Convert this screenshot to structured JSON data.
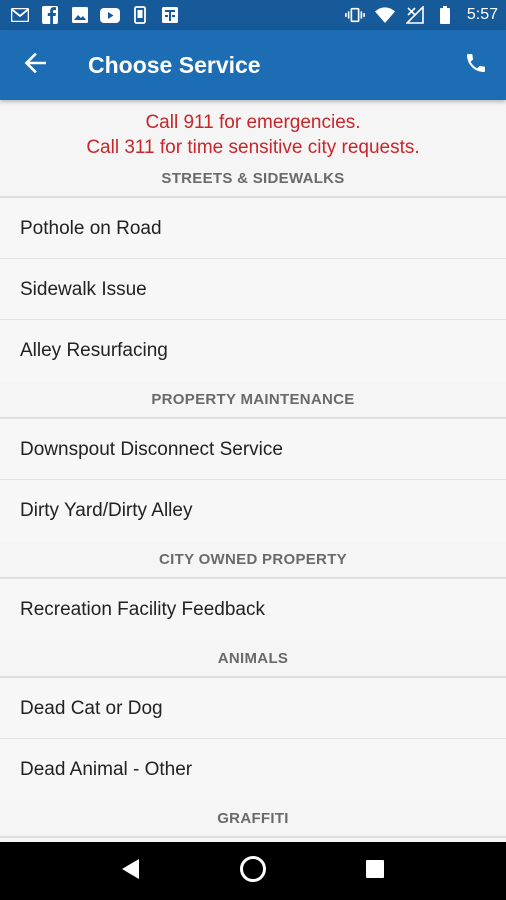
{
  "status_bar": {
    "time": "5:57",
    "left_icons": [
      "gmail-icon",
      "facebook-icon",
      "photo-icon",
      "youtube-icon",
      "device-icon",
      "news-icon"
    ],
    "right_icons": [
      "vibrate-icon",
      "wifi-icon",
      "no-signal-icon",
      "battery-icon"
    ]
  },
  "app_bar": {
    "title": "Choose Service",
    "back_icon": "arrow-back-icon",
    "action_icon": "phone-icon"
  },
  "notice": {
    "line1": "Call 911 for emergencies.",
    "line2": "Call 311 for time sensitive city requests."
  },
  "sections": [
    {
      "header": "STREETS & SIDEWALKS",
      "items": [
        "Pothole on Road",
        "Sidewalk Issue",
        "Alley Resurfacing"
      ]
    },
    {
      "header": "PROPERTY MAINTENANCE",
      "items": [
        "Downspout Disconnect Service",
        "Dirty Yard/Dirty Alley"
      ]
    },
    {
      "header": "CITY OWNED PROPERTY",
      "items": [
        "Recreation Facility Feedback"
      ]
    },
    {
      "header": "ANIMALS",
      "items": [
        "Dead Cat or Dog",
        "Dead Animal - Other"
      ]
    },
    {
      "header": "GRAFFITI",
      "items": []
    }
  ],
  "nav_bar": {
    "icons": [
      "back-triangle-icon",
      "home-circle-icon",
      "recents-square-icon"
    ]
  },
  "colors": {
    "status_bar": "#165a9a",
    "app_bar": "#1c6db3",
    "notice_text": "#c8262b",
    "section_header_text": "#6a6a6a"
  }
}
